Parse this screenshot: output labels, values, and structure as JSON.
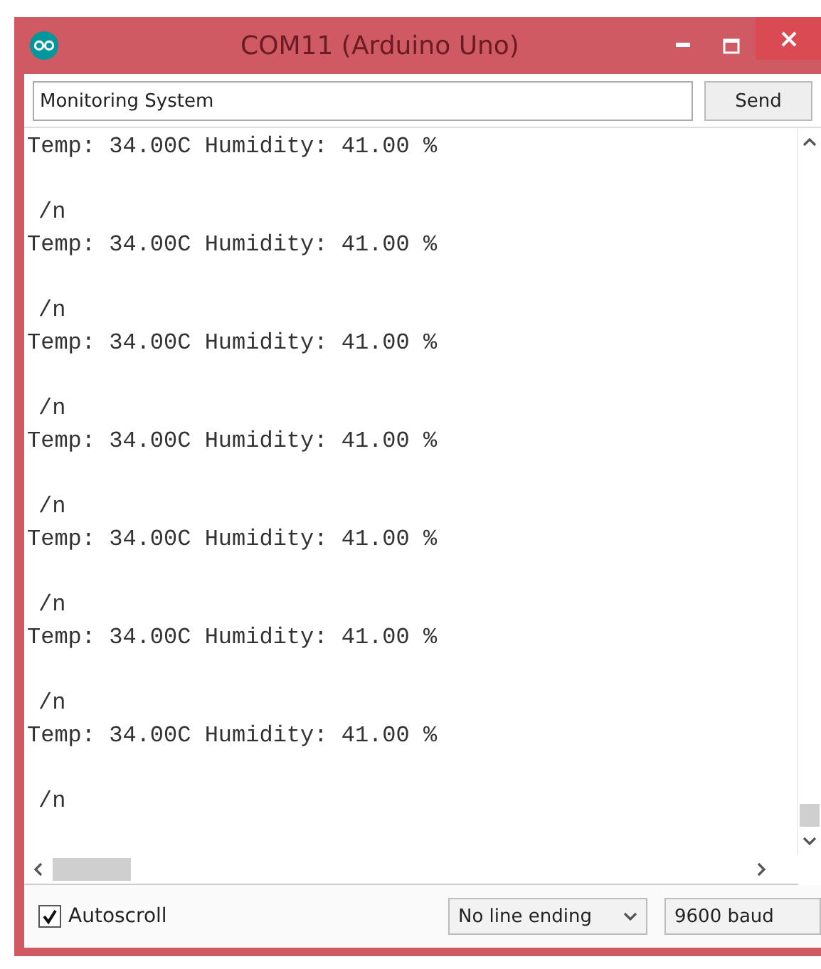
{
  "window": {
    "title": "COM11 (Arduino Uno)"
  },
  "input": {
    "value": "Monitoring System"
  },
  "send_button": "Send",
  "output": {
    "lines": [
      {
        "kind": "reading",
        "text": "Temp: 34.00C Humidity: 41.00 %"
      },
      {
        "kind": "marker",
        "text": "/n"
      },
      {
        "kind": "reading",
        "text": "Temp: 34.00C Humidity: 41.00 %"
      },
      {
        "kind": "marker",
        "text": "/n"
      },
      {
        "kind": "reading",
        "text": "Temp: 34.00C Humidity: 41.00 %"
      },
      {
        "kind": "marker",
        "text": "/n"
      },
      {
        "kind": "reading",
        "text": "Temp: 34.00C Humidity: 41.00 %"
      },
      {
        "kind": "marker",
        "text": "/n"
      },
      {
        "kind": "reading",
        "text": "Temp: 34.00C Humidity: 41.00 %"
      },
      {
        "kind": "marker",
        "text": "/n"
      },
      {
        "kind": "reading",
        "text": "Temp: 34.00C Humidity: 41.00 %"
      },
      {
        "kind": "marker",
        "text": "/n"
      },
      {
        "kind": "reading",
        "text": "Temp: 34.00C Humidity: 41.00 %"
      },
      {
        "kind": "marker",
        "text": "/n"
      }
    ]
  },
  "autoscroll": {
    "label": "Autoscroll",
    "checked": true
  },
  "line_ending": "No line ending",
  "baud": "9600 baud"
}
